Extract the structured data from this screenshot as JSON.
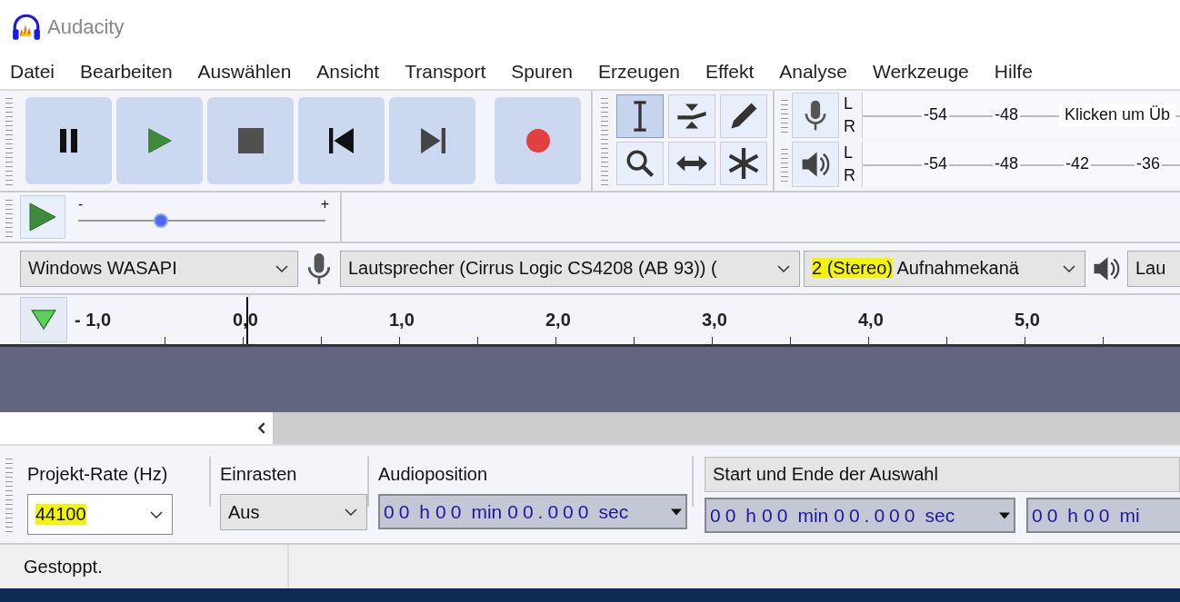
{
  "window": {
    "title": "Audacity"
  },
  "menu": [
    "Datei",
    "Bearbeiten",
    "Auswählen",
    "Ansicht",
    "Transport",
    "Spuren",
    "Erzeugen",
    "Effekt",
    "Analyse",
    "Werkzeuge",
    "Hilfe"
  ],
  "transport": [
    {
      "kind": "pause"
    },
    {
      "kind": "play"
    },
    {
      "kind": "stop"
    },
    {
      "kind": "skip-start"
    },
    {
      "kind": "skip-end"
    },
    {
      "kind": "record"
    }
  ],
  "tools": [
    {
      "kind": "select",
      "selected": true
    },
    {
      "kind": "envelope",
      "selected": false
    },
    {
      "kind": "draw",
      "selected": false
    },
    {
      "kind": "zoom",
      "selected": false
    },
    {
      "kind": "timeshift",
      "selected": false
    },
    {
      "kind": "multi",
      "selected": false
    }
  ],
  "meters": [
    {
      "kind": "record",
      "channels": [
        "L",
        "R"
      ],
      "ticks": [
        "-54",
        "-48"
      ],
      "hint": "Klicken um Üb"
    },
    {
      "kind": "playback",
      "channels": [
        "L",
        "R"
      ],
      "ticks": [
        "-54",
        "-48",
        "-42",
        "-36"
      ]
    }
  ],
  "play_at_speed": {
    "min": "-",
    "max": "+",
    "level": 0.335
  },
  "devices": {
    "host": "Windows WASAPI",
    "recording_device": "Lautsprecher (Cirrus Logic CS4208 (AB 93)) (",
    "channels": {
      "highlighted": "2 (Stereo)",
      "rest": "Aufnahmekanä"
    },
    "playback_device": "Lau"
  },
  "ruler": [
    "- 1,0",
    "0,0",
    "1,0",
    "2,0",
    "3,0",
    "4,0",
    "5,0"
  ],
  "selection_toolbar": {
    "project_rate": {
      "label": "Projekt-Rate (Hz)",
      "value": "44100",
      "highlighted": true
    },
    "snap": {
      "label": "Einrasten",
      "value": "Aus"
    },
    "audio_position": {
      "label": "Audioposition",
      "time": [
        {
          "digits": "00",
          "unit": "h"
        },
        {
          "digits": "00",
          "unit": "min"
        },
        {
          "digits": "00.000",
          "unit": "sec"
        }
      ]
    },
    "selection": {
      "label": "Start und Ende der Auswahl",
      "start": [
        {
          "digits": "00",
          "unit": "h"
        },
        {
          "digits": "00",
          "unit": "min"
        },
        {
          "digits": "00.000",
          "unit": "sec"
        }
      ],
      "end": [
        {
          "digits": "00",
          "unit": "h"
        },
        {
          "digits": "00",
          "unit": "mi"
        }
      ]
    }
  },
  "status_bar": "Gestoppt."
}
